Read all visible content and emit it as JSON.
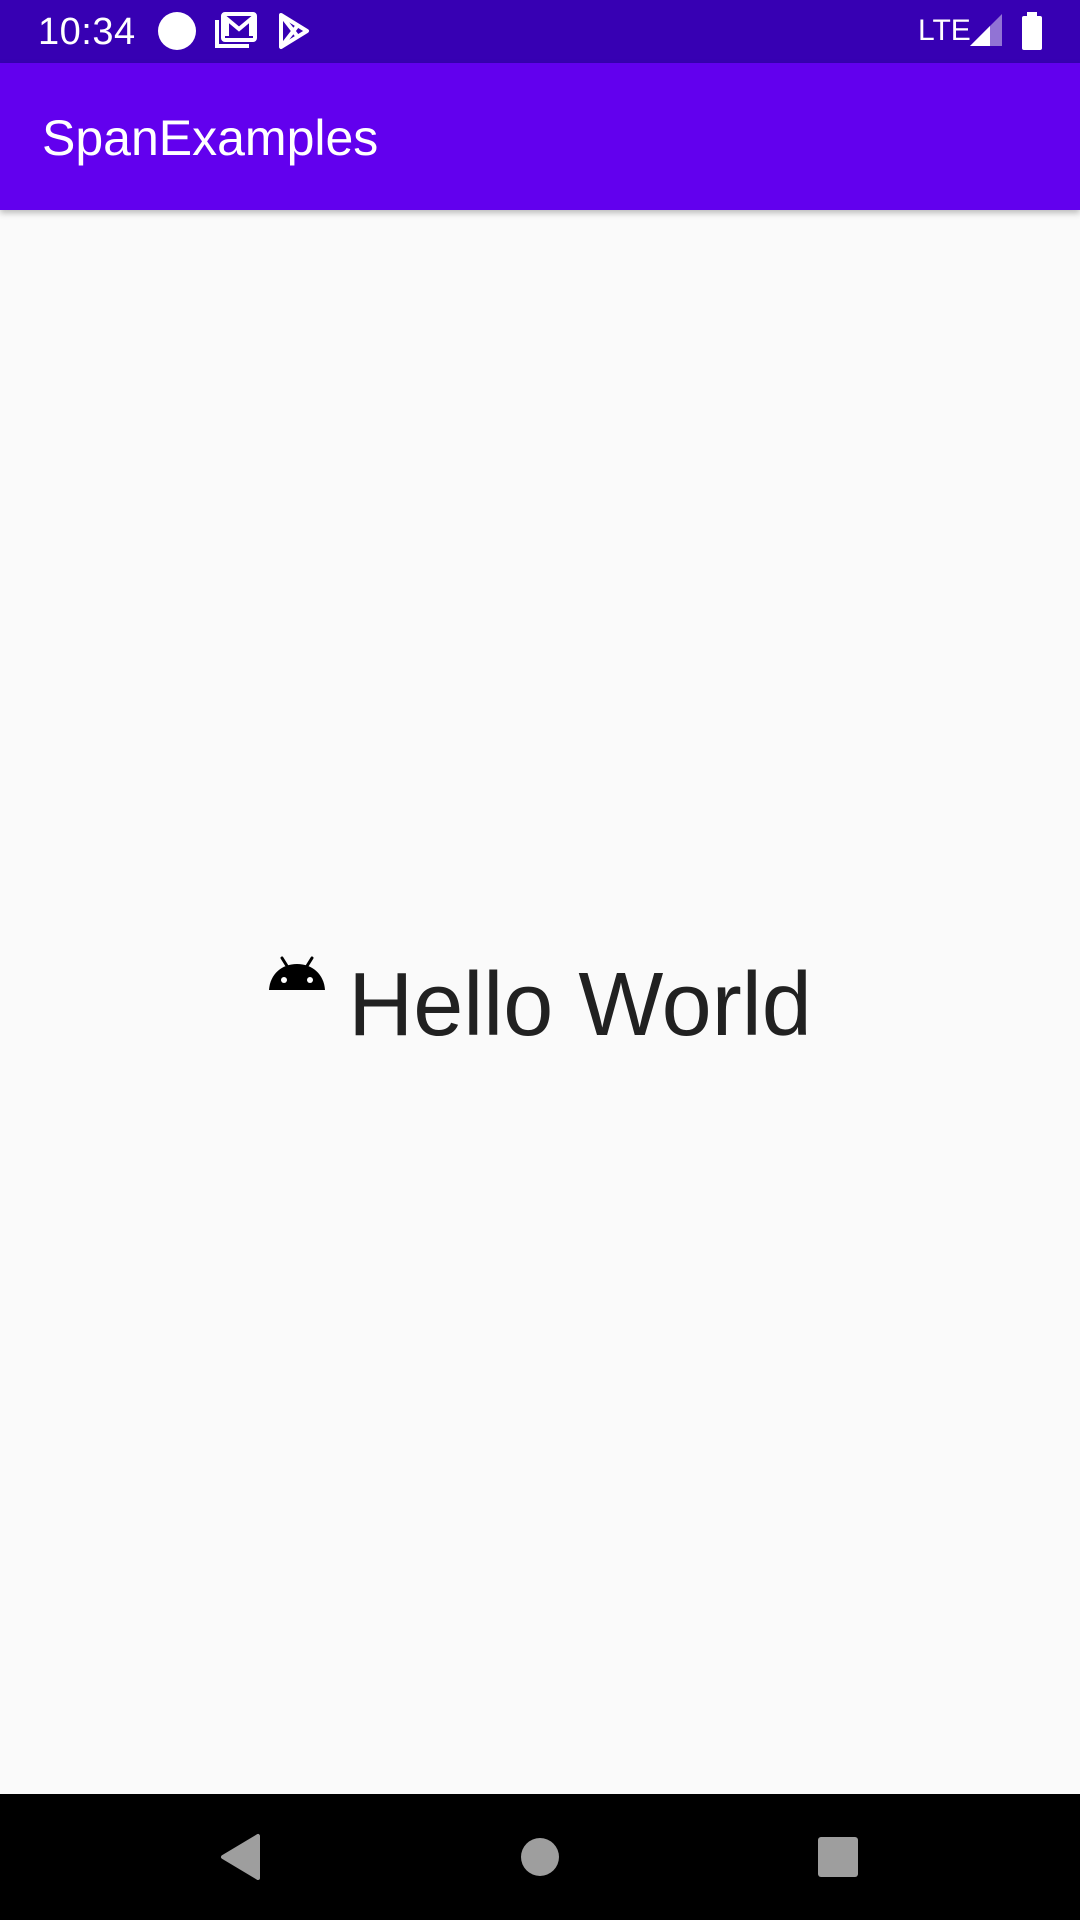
{
  "status_bar": {
    "time": "10:34",
    "network": "LTE",
    "icons": [
      "circle-notification-icon",
      "gmail-icon",
      "play-store-icon",
      "signal-icon",
      "battery-icon"
    ]
  },
  "app_bar": {
    "title": "SpanExamples"
  },
  "content": {
    "icon": "android-icon",
    "text": "Hello World"
  },
  "nav_bar": {
    "icons": [
      "back-icon",
      "home-icon",
      "recents-icon"
    ]
  },
  "colors": {
    "status_bar": "#3700b3",
    "app_bar": "#6200ee",
    "background": "#fafafa",
    "text": "#212121"
  }
}
